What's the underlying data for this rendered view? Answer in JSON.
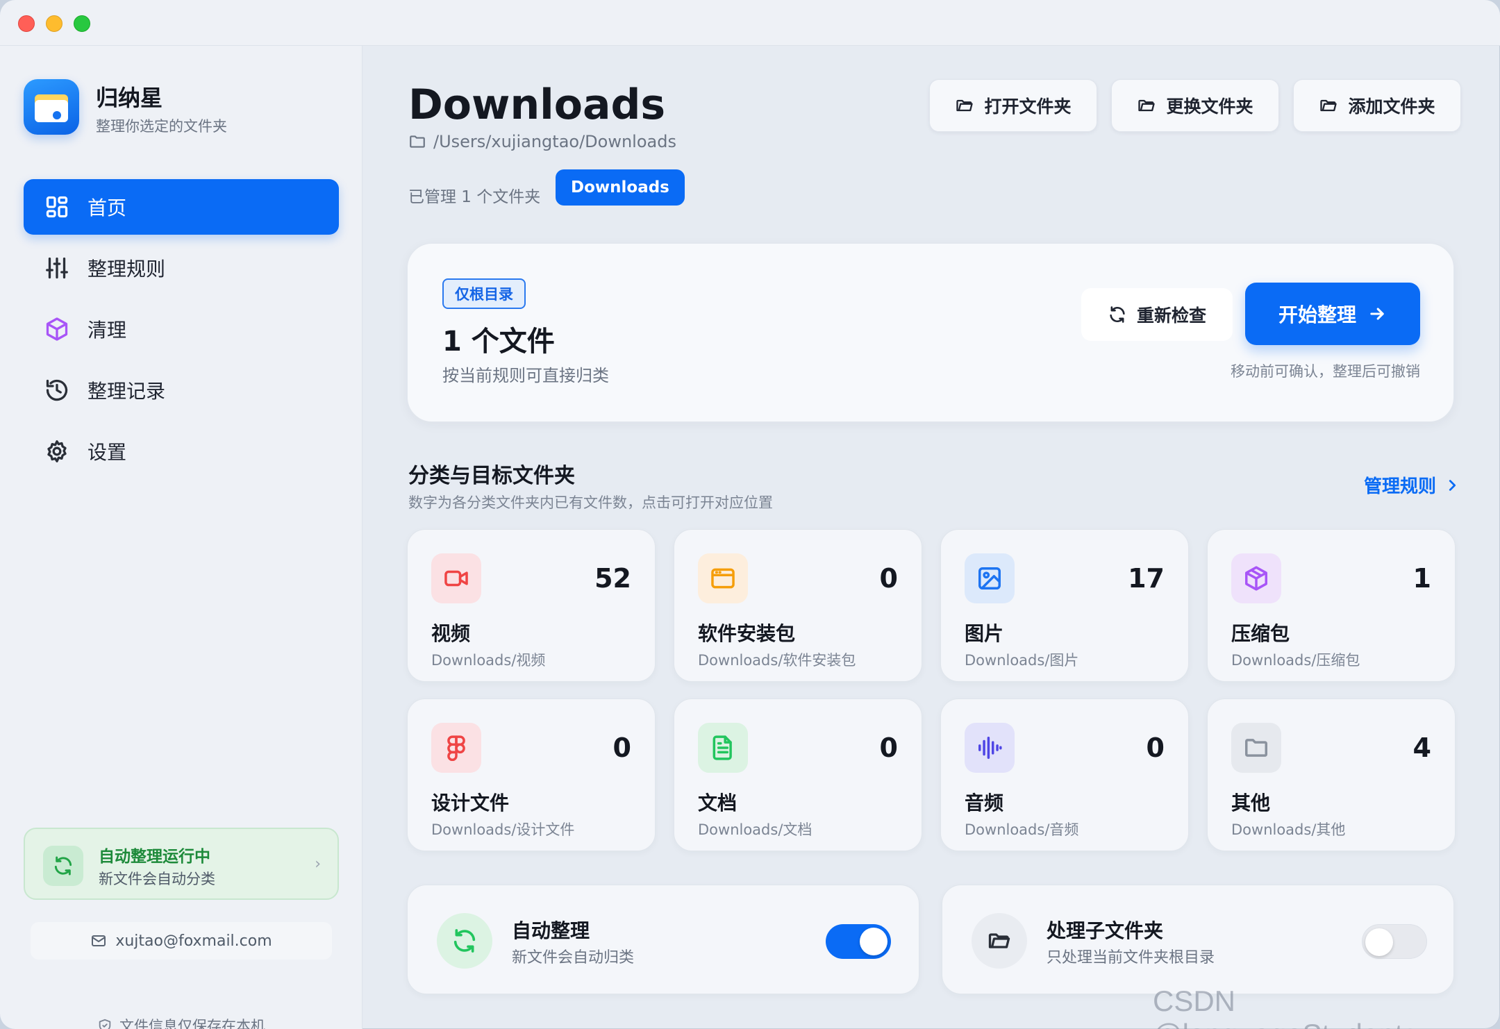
{
  "window": {
    "title": ""
  },
  "app": {
    "name": "归纳星",
    "subtitle": "整理你选定的文件夹"
  },
  "sidebar": {
    "items": [
      {
        "label": "首页",
        "icon": "grid-icon",
        "active": true
      },
      {
        "label": "整理规则",
        "icon": "sliders-icon",
        "active": false
      },
      {
        "label": "清理",
        "icon": "box-icon",
        "active": false
      },
      {
        "label": "整理记录",
        "icon": "history-icon",
        "active": false
      },
      {
        "label": "设置",
        "icon": "gear-icon",
        "active": false
      }
    ],
    "auto_status": {
      "title": "自动整理运行中",
      "subtitle": "新文件会自动分类",
      "chevron": "›"
    },
    "email": "xujtao@foxmail.com",
    "privacy_note": "文件信息仅保存在本机"
  },
  "header": {
    "title": "Downloads",
    "path": "/Users/xujiangtao/Downloads",
    "buttons": {
      "open": "打开文件夹",
      "change": "更换文件夹",
      "add": "添加文件夹"
    },
    "managed_count": "已管理 1 个文件夹",
    "folder_chip": "Downloads"
  },
  "summary": {
    "badge": "仅根目录",
    "count": "1 个文件",
    "description": "按当前规则可直接归类",
    "recheck_label": "重新检查",
    "start_label": "开始整理",
    "note": "移动前可确认，整理后可撤销"
  },
  "categories_section": {
    "title": "分类与目标文件夹",
    "subtitle": "数字为各分类文件夹内已有文件数，点击可打开对应位置",
    "manage_link": "管理规则"
  },
  "categories": [
    {
      "name": "视频",
      "count": "52",
      "path": "Downloads/视频",
      "icon": "video-icon",
      "color": "#ef4444",
      "bg": "#fbe1e4"
    },
    {
      "name": "软件安装包",
      "count": "0",
      "path": "Downloads/软件安装包",
      "icon": "app-window-icon",
      "color": "#f59e0b",
      "bg": "#fdeedd"
    },
    {
      "name": "图片",
      "count": "17",
      "path": "Downloads/图片",
      "icon": "image-icon",
      "color": "#1d74f2",
      "bg": "#dce9fb"
    },
    {
      "name": "压缩包",
      "count": "1",
      "path": "Downloads/压缩包",
      "icon": "package-icon",
      "color": "#a855f7",
      "bg": "#efe2fb"
    },
    {
      "name": "设计文件",
      "count": "0",
      "path": "Downloads/设计文件",
      "icon": "figma-icon",
      "color": "#ef4444",
      "bg": "#fbe1e4"
    },
    {
      "name": "文档",
      "count": "0",
      "path": "Downloads/文档",
      "icon": "document-icon",
      "color": "#22c55e",
      "bg": "#dcf3e3"
    },
    {
      "name": "音频",
      "count": "0",
      "path": "Downloads/音频",
      "icon": "audio-wave-icon",
      "color": "#4f46e5",
      "bg": "#e2e2fa"
    },
    {
      "name": "其他",
      "count": "4",
      "path": "Downloads/其他",
      "icon": "folder-icon",
      "color": "#8a929e",
      "bg": "#e6e9ee"
    }
  ],
  "toggles": [
    {
      "title": "自动整理",
      "subtitle": "新文件会自动归类",
      "on": true,
      "icon": "refresh-icon",
      "color": "#22c55e",
      "bg": "#dcf3e3"
    },
    {
      "title": "处理子文件夹",
      "subtitle": "只处理当前文件夹根目录",
      "on": false,
      "icon": "folder-open-icon",
      "color": "#2a2f38",
      "bg": "#e9ecf1"
    }
  ],
  "colors": {
    "accent": "#0a6bf5",
    "success": "#1d8a3a",
    "switch_on": "#0a6bf5",
    "switch_off": "#e7e9ee"
  },
  "watermark": "CSDN @languageStudents"
}
